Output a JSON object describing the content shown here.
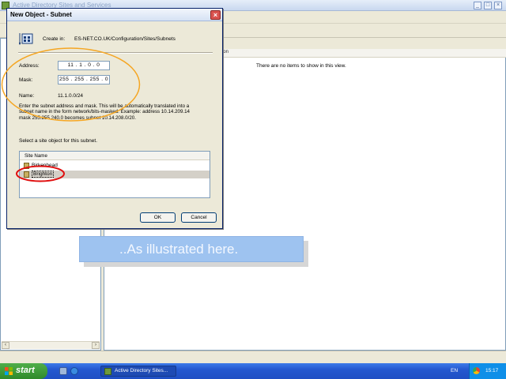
{
  "background_window": {
    "title": "Active Directory Sites and Services",
    "list_column_header": "ion",
    "empty_message": "There are no items to show in this view."
  },
  "dialog": {
    "title": "New Object - Subnet",
    "create_in_label": "Create in:",
    "create_in_path": "ES-NET.CO.UK/Configuration/Sites/Subnets",
    "address_label": "Address:",
    "address_value": "11 . 1 . 0 . 0",
    "mask_label": "Mask:",
    "mask_value": "255 . 255 . 255 . 0",
    "name_label": "Name:",
    "name_value": "11.1.0.0/24",
    "help_text": "Enter the subnet address and mask. This will be automatically translated into a subnet name in the form network/bits-masked. Example: address 10.14.209.14 mask 255.255.240.0 becomes subnet 10.14.208.0/20.",
    "select_label": "Select a site object for this subnet.",
    "site_list_header": "Site Name",
    "sites": [
      {
        "name": "Birkenhead",
        "selected": false
      },
      {
        "name": "Brighton",
        "selected": true
      }
    ],
    "ok_label": "OK",
    "cancel_label": "Cancel"
  },
  "caption": {
    "text": "..As illustrated here."
  },
  "taskbar": {
    "start_label": "start",
    "task_label": "Active Directory Sites...",
    "language": "EN",
    "clock": "15:17"
  },
  "colors": {
    "annotation_orange": "#f5a623",
    "annotation_red": "#e01010",
    "caption_bg": "#9ec3f0",
    "taskbar_blue": "#2458d0",
    "start_green": "#3a9a35"
  },
  "icons": [
    "site-object-icon",
    "close-icon",
    "site-icon",
    "windows-flag-icon",
    "browser-icon",
    "tray-icon"
  ]
}
